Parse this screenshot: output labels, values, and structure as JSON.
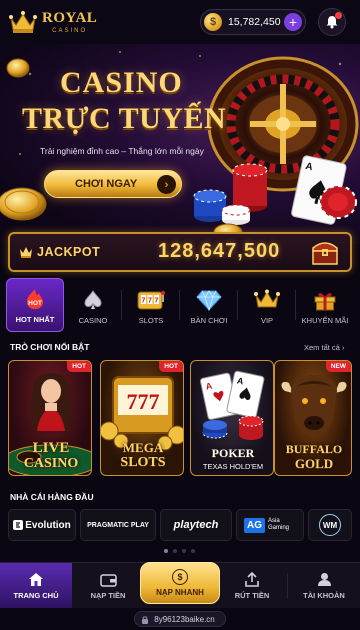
{
  "header": {
    "logo_top": "ROYAL",
    "logo_bottom": "CASINO",
    "balance": "15,782,450",
    "coin_symbol": "$"
  },
  "hero": {
    "title_line1": "CASINO",
    "title_line2": "TRỰC TUYẾN",
    "subtitle": "Trải nghiệm đỉnh cao – Thắng lớn mỗi ngày",
    "cta_label": "CHƠI NGAY"
  },
  "jackpot": {
    "label": "JACKPOT",
    "value": "128,647,500"
  },
  "categories": [
    {
      "label": "HOT NHẤT",
      "badge": "HOT",
      "icon": "hot-flame-icon",
      "active": true
    },
    {
      "label": "CASINO",
      "icon": "spade-icon"
    },
    {
      "label": "SLOTS",
      "icon": "slot-machine-icon"
    },
    {
      "label": "BÀN CHƠI",
      "icon": "diamond-icon"
    },
    {
      "label": "VIP",
      "icon": "crown-icon"
    },
    {
      "label": "KHUYẾN MÃI",
      "icon": "gift-icon"
    }
  ],
  "featured": {
    "title": "TRÒ CHƠI NỔI BẬT",
    "see_all": "Xem tất cả",
    "games": [
      {
        "title_line1": "LIVE",
        "title_line2": "CASINO",
        "badge": "HOT"
      },
      {
        "title_line1": "MEGA",
        "title_line2": "SLOTS",
        "badge": "HOT",
        "reel": "777"
      },
      {
        "title_line1": "POKER",
        "subtitle": "TEXAS HOLD'EM"
      },
      {
        "title_line1": "BUFFALO",
        "title_line2": "GOLD",
        "badge": "NEW"
      }
    ]
  },
  "providers": {
    "title": "NHÀ CÁI HÀNG ĐẦU",
    "items": [
      {
        "name": "Evolution"
      },
      {
        "name": "PRAGMATIC PLAY"
      },
      {
        "name": "playtech"
      },
      {
        "name": "AG",
        "sub": "Asia Gaming"
      },
      {
        "name": "WM"
      }
    ]
  },
  "bottom_nav": [
    {
      "label": "TRANG CHỦ",
      "icon": "home-icon",
      "active": true
    },
    {
      "label": "NẠP TIỀN",
      "icon": "wallet-icon"
    },
    {
      "label": "NẠP NHANH",
      "icon": "dollar-coin-icon"
    },
    {
      "label": "RÚT TIỀN",
      "icon": "upload-icon"
    },
    {
      "label": "TÀI KHOẢN",
      "icon": "user-icon"
    }
  ],
  "url": "8y96123baike.cn",
  "colors": {
    "gold": "#ffd466",
    "purple_accent": "#6a28c7",
    "badge_red": "#e0242c",
    "background": "#0a0612"
  }
}
